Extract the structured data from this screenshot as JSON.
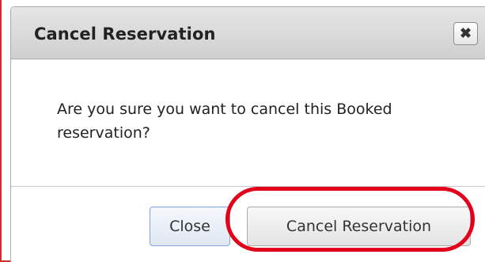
{
  "dialog": {
    "title": "Cancel Reservation",
    "close_icon_glyph": "✖",
    "message": "Are you sure you want to cancel this Booked reservation?",
    "buttons": {
      "close_label": "Close",
      "cancel_reservation_label": "Cancel Reservation"
    }
  },
  "annotation": {
    "highlight_color": "#e3001b",
    "highlighted_element": "cancel-reservation-button"
  }
}
